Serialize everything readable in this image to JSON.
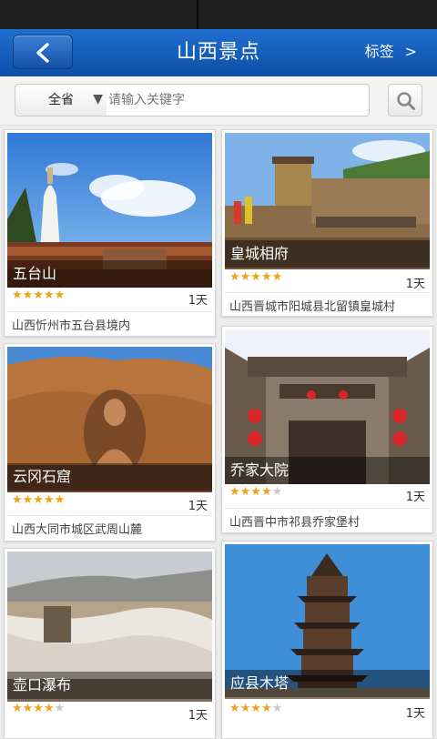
{
  "navbar": {
    "title": "山西景点",
    "tag_label": "标签",
    "tag_chevron": ">"
  },
  "search": {
    "province": "全省",
    "placeholder": "请输入关键字"
  },
  "spots": [
    {
      "name": "五台山",
      "rating": 5,
      "duration": "1天",
      "address": "山西忻州市五台县境内"
    },
    {
      "name": "皇城相府",
      "rating": 5,
      "duration": "1天",
      "address": "山西晋城市阳城县北留镇皇城村"
    },
    {
      "name": "云冈石窟",
      "rating": 5,
      "duration": "1天",
      "address": "山西大同市城区武周山麓"
    },
    {
      "name": "乔家大院",
      "rating": 4,
      "duration": "1天",
      "address": "山西晋中市祁县乔家堡村"
    },
    {
      "name": "壶口瀑布",
      "rating": 4,
      "duration": "1天",
      "address": ""
    },
    {
      "name": "应县木塔",
      "rating": 4,
      "duration": "1天",
      "address": ""
    }
  ],
  "colors": {
    "navbar": "#1560bd",
    "star": "#f0a21a",
    "star_off": "#c9c9c9"
  }
}
